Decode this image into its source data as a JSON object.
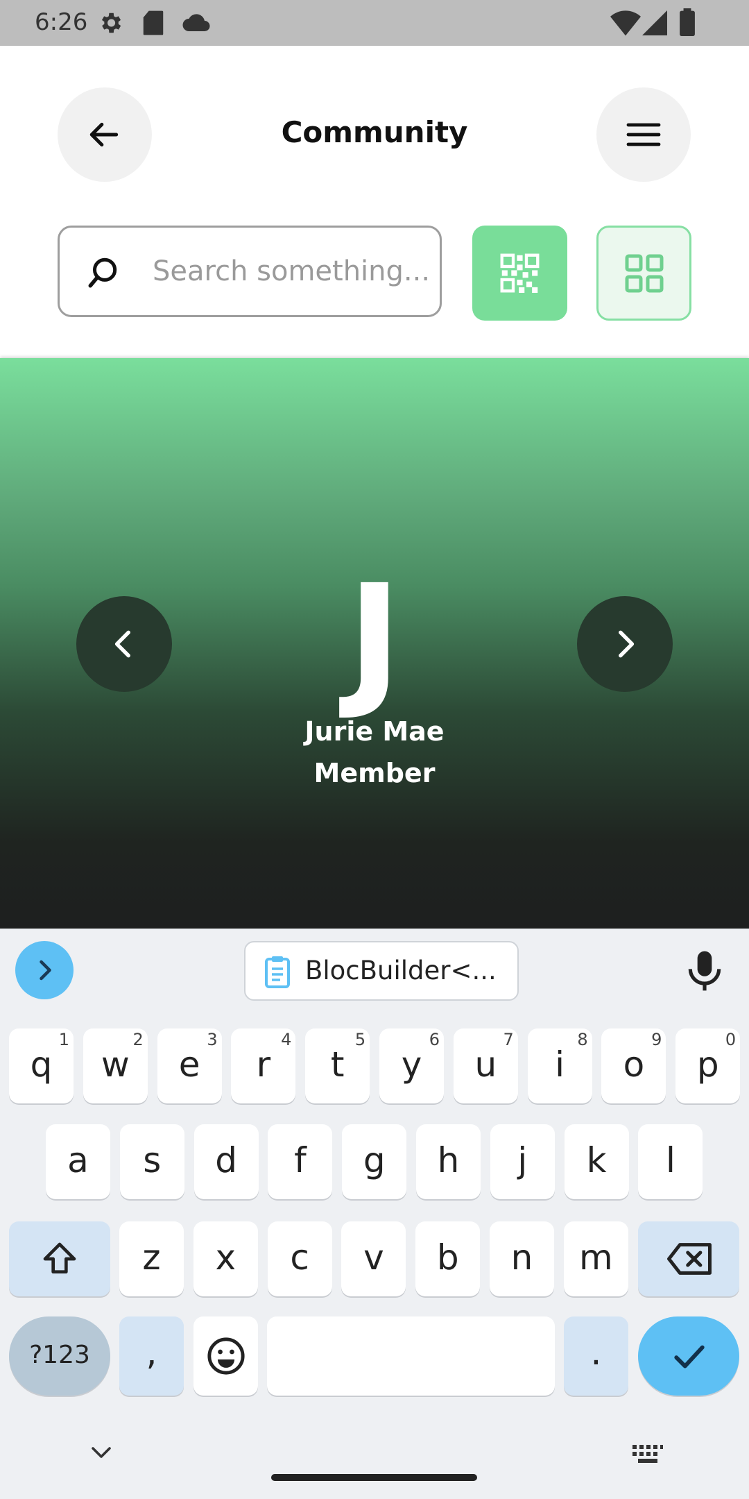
{
  "status_bar": {
    "time": "6:26"
  },
  "header": {
    "title": "Community"
  },
  "search": {
    "placeholder": "Search something..."
  },
  "profile": {
    "initial": "J",
    "name": "Jurie Mae",
    "role": "Member"
  },
  "keyboard": {
    "clipboard_suggestion": "BlocBuilder<...",
    "row1": [
      {
        "key": "q",
        "hint": "1"
      },
      {
        "key": "w",
        "hint": "2"
      },
      {
        "key": "e",
        "hint": "3"
      },
      {
        "key": "r",
        "hint": "4"
      },
      {
        "key": "t",
        "hint": "5"
      },
      {
        "key": "y",
        "hint": "6"
      },
      {
        "key": "u",
        "hint": "7"
      },
      {
        "key": "i",
        "hint": "8"
      },
      {
        "key": "o",
        "hint": "9"
      },
      {
        "key": "p",
        "hint": "0"
      }
    ],
    "row2": [
      "a",
      "s",
      "d",
      "f",
      "g",
      "h",
      "j",
      "k",
      "l"
    ],
    "row3": [
      "z",
      "x",
      "c",
      "v",
      "b",
      "n",
      "m"
    ],
    "symbols_label": "?123",
    "comma": ",",
    "period": "."
  },
  "colors": {
    "accent_green": "#79dd99",
    "keyboard_blue": "#5ec0f4",
    "hero_dark": "#1e1f1f"
  }
}
